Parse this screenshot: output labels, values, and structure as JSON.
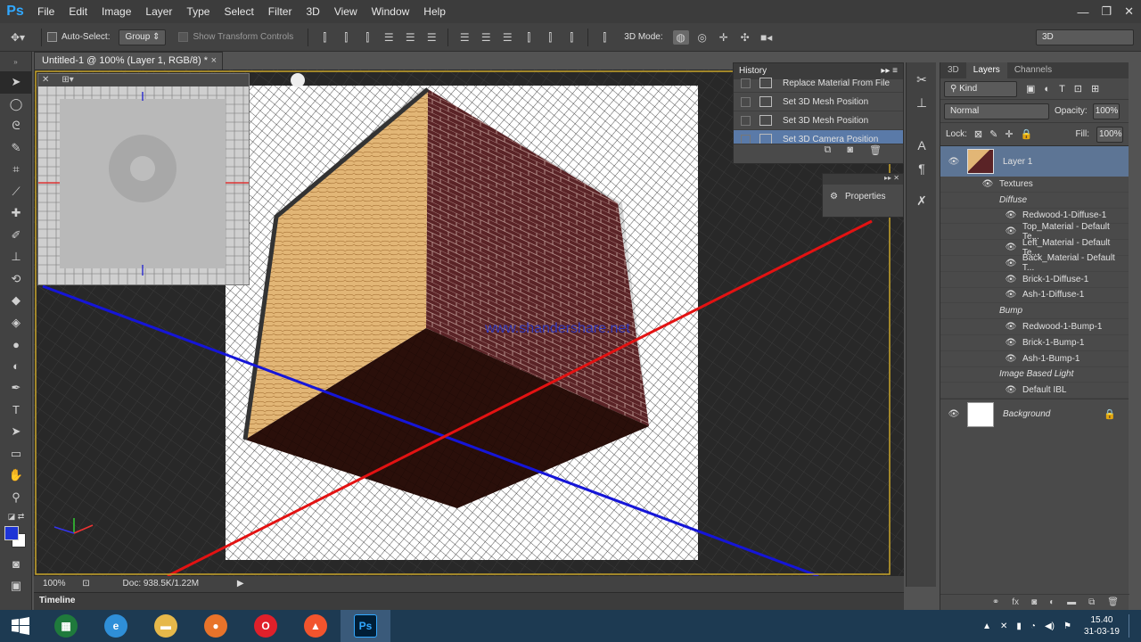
{
  "app": {
    "logo": "Ps",
    "accent": "#31a8ff"
  },
  "menu": [
    "File",
    "Edit",
    "Image",
    "Layer",
    "Type",
    "Select",
    "Filter",
    "3D",
    "View",
    "Window",
    "Help"
  ],
  "window_controls": {
    "minimize": "—",
    "restore": "❐",
    "close": "✕"
  },
  "options_bar": {
    "auto_select_label": "Auto-Select:",
    "auto_select_value": "Group",
    "show_transform_label": "Show Transform Controls",
    "mode_label": "3D Mode:",
    "workspace": "3D"
  },
  "document": {
    "tab_title": "Untitled-1 @ 100% (Layer 1, RGB/8) *",
    "close": "×",
    "watermark": "www.shandershare.net"
  },
  "status": {
    "zoom": "100%",
    "doc_info": "Doc: 938.5K/1.22M"
  },
  "timeline_label": "Timeline",
  "history": {
    "title": "History",
    "items": [
      {
        "label": "Replace Material From File",
        "selected": false
      },
      {
        "label": "Set 3D Mesh Position",
        "selected": false
      },
      {
        "label": "Set 3D Mesh Position",
        "selected": false
      },
      {
        "label": "Set 3D Camera Position",
        "selected": true
      }
    ]
  },
  "properties": {
    "label": "Properties"
  },
  "layers": {
    "tabs": [
      "3D",
      "Layers",
      "Channels"
    ],
    "active_tab": "Layers",
    "filter_kind": "Kind",
    "blend_mode": "Normal",
    "opacity_label": "Opacity:",
    "opacity_value": "100%",
    "lock_label": "Lock:",
    "fill_label": "Fill:",
    "fill_value": "100%",
    "layer1": {
      "name": "Layer 1",
      "textures_label": "Textures",
      "groups": [
        {
          "name": "Diffuse",
          "items": [
            "Redwood-1-Diffuse-1",
            "Top_Material - Default Te...",
            "Left_Material - Default Te...",
            "Back_Material - Default T...",
            "Brick-1-Diffuse-1",
            "Ash-1-Diffuse-1"
          ]
        },
        {
          "name": "Bump",
          "items": [
            "Redwood-1-Bump-1",
            "Brick-1-Bump-1",
            "Ash-1-Bump-1"
          ]
        },
        {
          "name": "Image Based Light",
          "items": [
            "Default IBL"
          ]
        }
      ]
    },
    "background": {
      "name": "Background"
    }
  },
  "taskbar": {
    "time": "15.40",
    "date": "31-03-19",
    "apps": [
      {
        "name": "excel",
        "color": "#1f7a3c",
        "glyph": "▦"
      },
      {
        "name": "ie",
        "color": "#2f8fd8",
        "glyph": "e"
      },
      {
        "name": "explorer",
        "color": "#e6b84a",
        "glyph": "▬"
      },
      {
        "name": "firefox",
        "color": "#e8732a",
        "glyph": "●"
      },
      {
        "name": "opera",
        "color": "#e0202a",
        "glyph": "O"
      },
      {
        "name": "brave",
        "color": "#f2542d",
        "glyph": "▲"
      },
      {
        "name": "photoshop",
        "color": "#001e36",
        "glyph": "Ps"
      }
    ]
  }
}
